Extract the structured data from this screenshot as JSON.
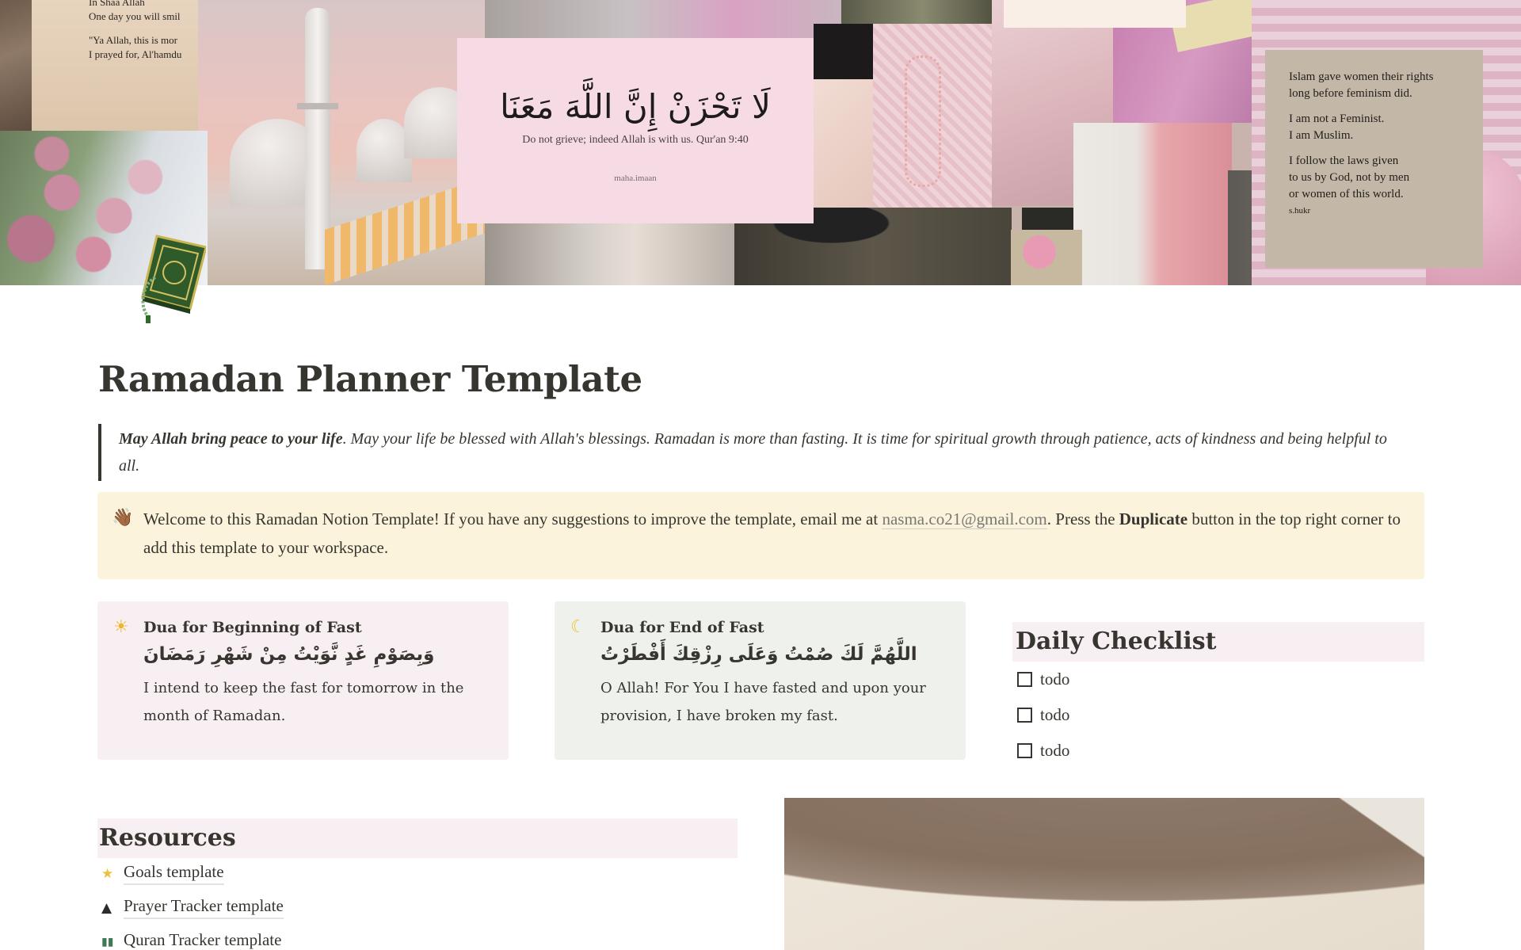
{
  "cover": {
    "note_lines": [
      "In Shaa Allah",
      "One day you will smil",
      "",
      "\"Ya Allah, this is mor",
      "I prayed for, Al'hamdu"
    ],
    "quran_card": {
      "arabic": "لَا تَحْزَنْ إِنَّ اللَّهَ مَعَنَا",
      "english": "Do not grieve; indeed Allah is with us. Qur'an 9:40",
      "credit": "maha.imaan"
    },
    "quote_card": {
      "lines_1": [
        "Islam gave women their rights",
        "long before feminism did."
      ],
      "lines_2": [
        "I am not a Feminist.",
        "I am Muslim."
      ],
      "lines_3": [
        "I follow the laws given",
        "to us by God, not by men",
        "or women of this world."
      ],
      "signature": "s.hukr"
    }
  },
  "page": {
    "icon": "quran-book-icon",
    "title": "Ramadan Planner Template"
  },
  "quote": {
    "bold": "May Allah bring peace to your life",
    "rest": ". May your life be blessed with Allah's blessings. Ramadan is more than fasting. It is time for spiritual growth through patience, acts of kindness and being helpful to all."
  },
  "callout": {
    "icon": "👋🏾",
    "text_before": "Welcome to this Ramadan Notion Template! If you have any suggestions to improve the template, email me at ",
    "email": "nasma.co21@gmail.com",
    "text_mid": ". Press the ",
    "bold": "Duplicate",
    "text_after": " button in the top right corner to add this template to your workspace."
  },
  "duas": [
    {
      "icon": "☀",
      "title": "Dua for Beginning of Fast",
      "arabic": "وَبِصَوْمِ غَدٍ نَّوَيْتُ مِنْ شَهْرِ رَمَضَانَ",
      "translation": "I intend to keep the fast for tomorrow in the month of Ramadan.",
      "color": "#f8eff2"
    },
    {
      "icon": "☾",
      "title": "Dua for End of Fast",
      "arabic": "اللَّهُمَّ لَكَ صُمْتُ وَعَلَى رِزْقِكَ أَفْطَرْتُ",
      "translation": "O Allah! For You I have fasted and upon your provision, I have broken my fast.",
      "color": "#eef1ec"
    }
  ],
  "checklist": {
    "heading": "Daily Checklist",
    "items": [
      {
        "label": "todo",
        "checked": false
      },
      {
        "label": "todo",
        "checked": false
      },
      {
        "label": "todo",
        "checked": false
      }
    ]
  },
  "resources": {
    "heading": "Resources",
    "items": [
      {
        "icon": "★",
        "label": "Goals template"
      },
      {
        "icon": "▲",
        "label": "Prayer Tracker template"
      },
      {
        "icon": "▮▮",
        "label": "Quran Tracker template"
      }
    ]
  },
  "colors": {
    "text": "#37352f",
    "callout_bg": "#fbf3db",
    "pink_bg": "#f8eff2",
    "green_bg": "#eef1ec",
    "link_gray": "#787774"
  }
}
